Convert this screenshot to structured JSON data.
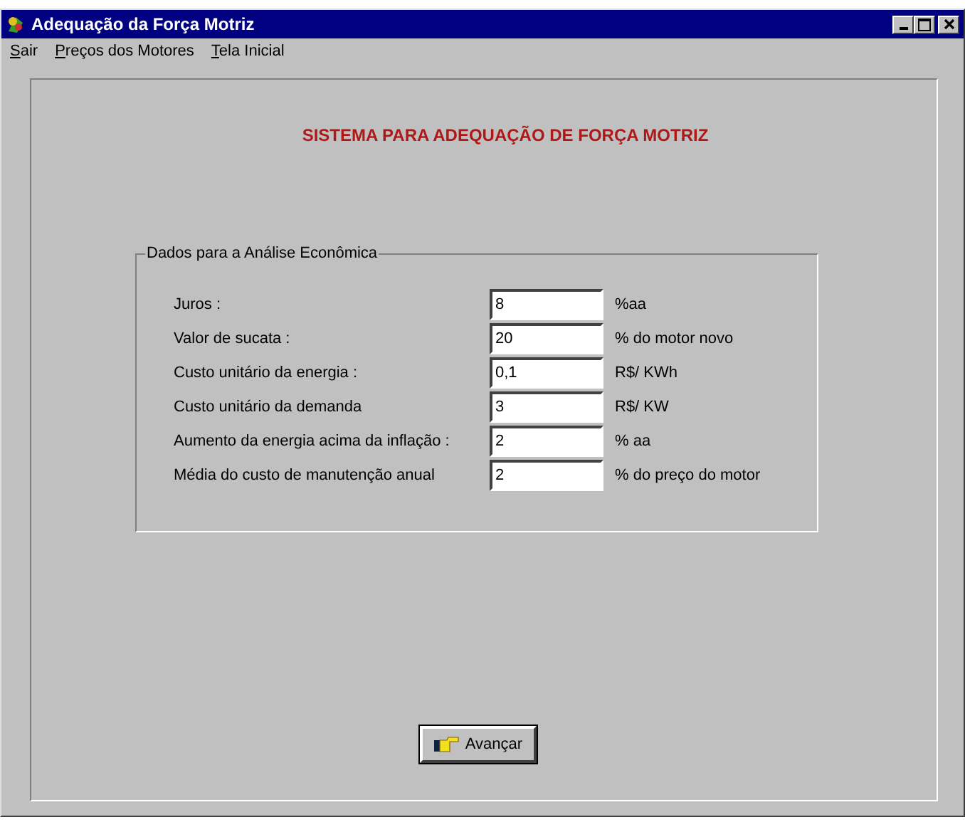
{
  "window": {
    "title": "Adequação da Força Motriz"
  },
  "menu": [
    {
      "label": "Sair"
    },
    {
      "label": "Preços dos Motores"
    },
    {
      "label": "Tela Inicial"
    }
  ],
  "heading": "SISTEMA PARA ADEQUAÇÃO DE FORÇA MOTRIZ",
  "group": {
    "title": "Dados para a Análise Econômica",
    "fields": [
      {
        "label": "Juros :",
        "value": "8",
        "unit": "%aa"
      },
      {
        "label": "Valor de sucata :",
        "value": "20",
        "unit": "% do motor novo"
      },
      {
        "label": "Custo unitário da energia :",
        "value": "0,1",
        "unit": "R$/ KWh"
      },
      {
        "label": "Custo unitário da demanda",
        "value": "3",
        "unit": "R$/ KW"
      },
      {
        "label": "Aumento da energia acima da inflação :",
        "value": "2",
        "unit": "% aa"
      },
      {
        "label": "Média do custo de manutenção anual",
        "value": "2",
        "unit": "% do preço do motor"
      }
    ]
  },
  "button": {
    "label": "Avançar"
  }
}
